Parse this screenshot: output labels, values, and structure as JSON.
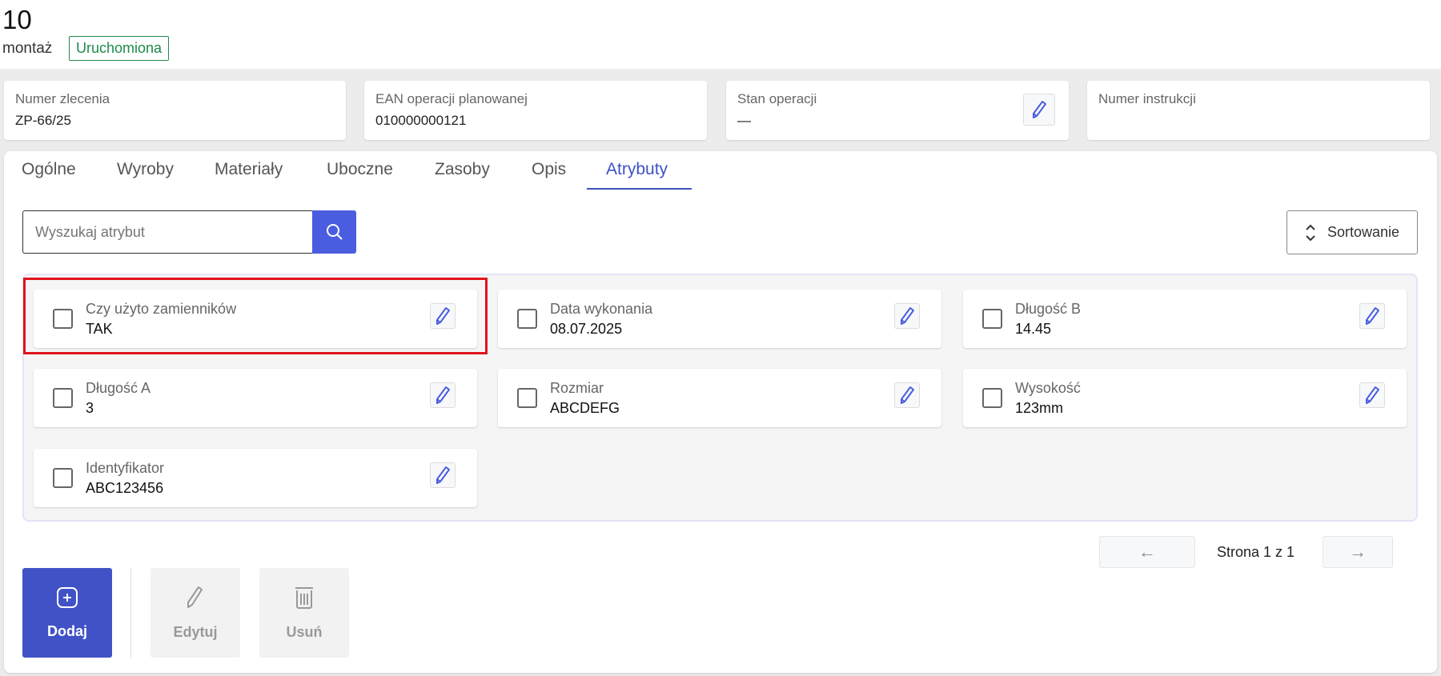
{
  "header": {
    "title": "10",
    "subtitle": "montaż",
    "status": "Uruchomiona"
  },
  "info_cards": [
    {
      "label": "Numer zlecenia",
      "value": "ZP-66/25"
    },
    {
      "label": "EAN operacji planowanej",
      "value": "010000000121"
    },
    {
      "label": "Stan operacji",
      "value": "—"
    },
    {
      "label": "Numer instrukcji",
      "value": ""
    }
  ],
  "tabs": [
    "Ogólne",
    "Wyroby",
    "Materiały",
    "Uboczne",
    "Zasoby",
    "Opis",
    "Atrybuty"
  ],
  "active_tab": "Atrybuty",
  "search": {
    "placeholder": "Wyszukaj atrybut"
  },
  "sort_label": "Sortowanie",
  "attributes": [
    {
      "label": "Czy użyto zamienników",
      "value": "TAK",
      "highlighted": true
    },
    {
      "label": "Data wykonania",
      "value": "08.07.2025"
    },
    {
      "label": "Długość B",
      "value": "14.45"
    },
    {
      "label": "Długość A",
      "value": "3"
    },
    {
      "label": "Rozmiar",
      "value": "ABCDEFG"
    },
    {
      "label": "Wysokość",
      "value": "123mm"
    },
    {
      "label": "Identyfikator",
      "value": "ABC123456"
    }
  ],
  "pagination": {
    "text": "Strona 1 z 1"
  },
  "actions": {
    "add": "Dodaj",
    "edit": "Edytuj",
    "delete": "Usuń"
  },
  "colors": {
    "accent": "#3f51c4",
    "status": "#1e8a4a",
    "highlight": "#e0141c"
  }
}
